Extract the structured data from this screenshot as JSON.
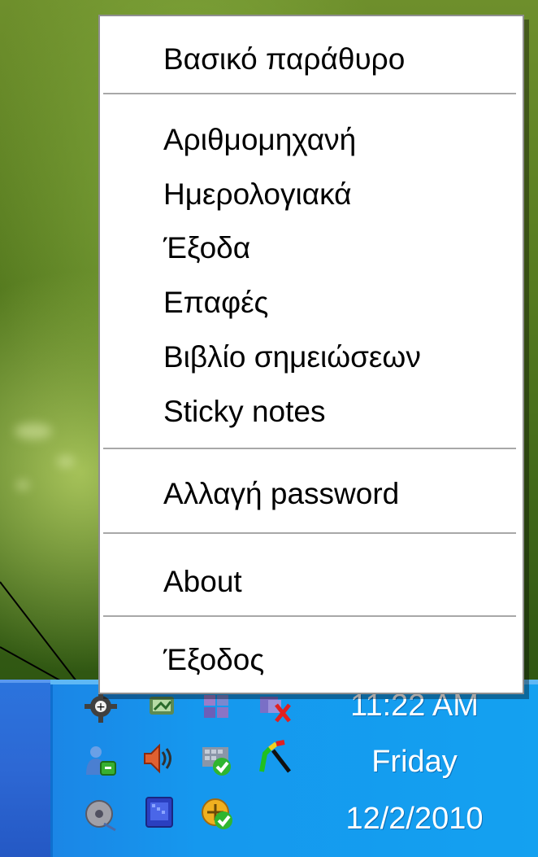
{
  "menu": {
    "items": [
      {
        "label": "Βασικό παράθυρο"
      },
      {
        "label": "Αριθμομηχανή"
      },
      {
        "label": "Ημερολογιακά"
      },
      {
        "label": "Έξοδα"
      },
      {
        "label": "Επαφές"
      },
      {
        "label": "Βιβλίο σημειώσεων"
      },
      {
        "label": "Sticky notes"
      },
      {
        "label": "Αλλαγή password"
      },
      {
        "label": "About"
      },
      {
        "label": "Έξοδος"
      }
    ]
  },
  "tray": {
    "time": "11:22 AM",
    "day": "Friday",
    "date": "12/2/2010",
    "icons": [
      "gear-app-icon",
      "network-monitor-icon",
      "windows-flag-icon",
      "disconnected-network-icon",
      "messenger-user-icon",
      "volume-speaker-icon",
      "security-center-shield-icon",
      "colorful-pen-icon",
      "cd-drive-icon",
      "display-settings-icon",
      "update-check-icon"
    ]
  },
  "colors": {
    "taskbar": "#1598ee",
    "menu_bg": "#ffffff",
    "separator": "#a8a8a8"
  }
}
